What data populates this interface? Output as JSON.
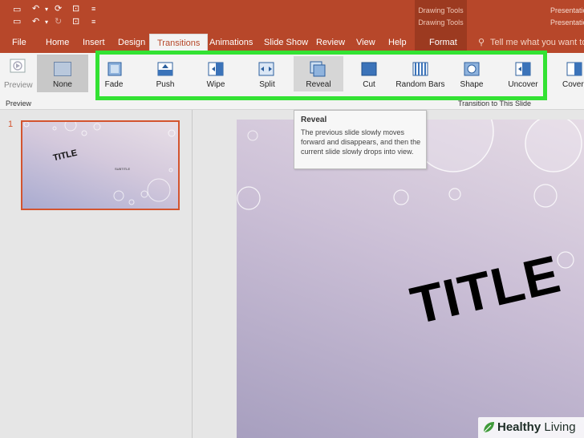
{
  "tabs": [
    "File",
    "Home",
    "Insert",
    "Design",
    "Transitions",
    "Animations",
    "Slide Show",
    "Review",
    "View",
    "Help",
    "Format"
  ],
  "active_tab": "Transitions",
  "context_labels": [
    "Drawing Tools",
    "Drawing Tools"
  ],
  "title_right": [
    "Presentatio",
    "Presentatio"
  ],
  "tell_me": "Tell me what you want to do",
  "ribbon": {
    "preview_label": "Preview",
    "preview_group_label": "Preview",
    "none_label": "None",
    "group_label": "Transition to This Slide",
    "transitions": [
      "Fade",
      "Push",
      "Wipe",
      "Split",
      "Reveal",
      "Cut",
      "Random Bars",
      "Shape",
      "Uncover",
      "Cover"
    ],
    "selected": "Reveal"
  },
  "slide_panel": {
    "slide_number": "1",
    "thumb_title": "TITLE",
    "thumb_subtitle": "SUBTITLE"
  },
  "slide": {
    "title": "TITLE"
  },
  "tooltip": {
    "title": "Reveal",
    "body": "The previous slide slowly moves forward and disappears, and then the current slide slowly drops into view."
  },
  "watermark": {
    "brand": "Healthy",
    "brand2": "Living"
  },
  "colors": {
    "accent": "#b7472a",
    "highlight_green": "#33e233",
    "thumb_border": "#d3542f"
  }
}
